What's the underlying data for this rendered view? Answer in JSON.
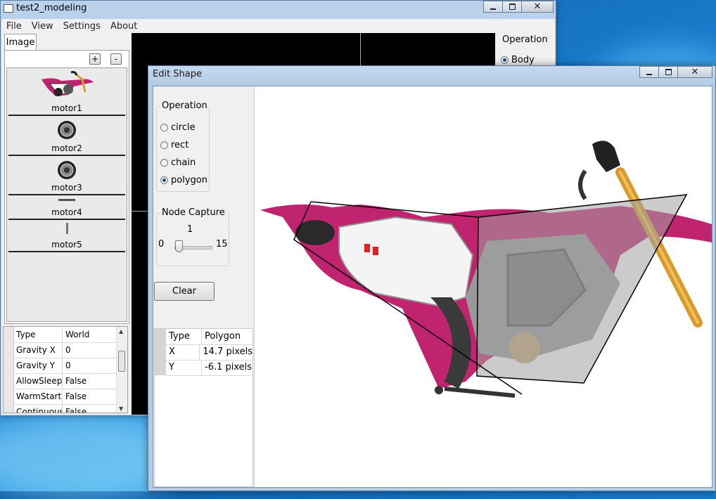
{
  "main_window": {
    "title": "test2_modeling",
    "menu": [
      "File",
      "View",
      "Settings",
      "About"
    ],
    "tab": "Image",
    "add_label": "+",
    "remove_label": "-",
    "images": [
      {
        "label": "motor1"
      },
      {
        "label": "motor2"
      },
      {
        "label": "motor3"
      },
      {
        "label": "motor4"
      },
      {
        "label": "motor5"
      }
    ],
    "properties": [
      {
        "key": "Type",
        "value": "World"
      },
      {
        "key": "Gravity X",
        "value": "0"
      },
      {
        "key": "Gravity Y",
        "value": "0"
      },
      {
        "key": "AllowSleep",
        "value": "False"
      },
      {
        "key": "WarmStarti",
        "value": "False"
      },
      {
        "key": "Continuous",
        "value": "False"
      }
    ],
    "operation_title": "Operation",
    "operation_selected": "Body"
  },
  "edit_dialog": {
    "title": "Edit Shape",
    "operation_title": "Operation",
    "options": [
      "circle",
      "rect",
      "chain",
      "polygon"
    ],
    "selected": "polygon",
    "node_capture_title": "Node Capture",
    "slider_value": "1",
    "slider_min": "0",
    "slider_max": "15",
    "clear_label": "Clear",
    "info": [
      {
        "key": "Type",
        "value": "Polygon"
      },
      {
        "key": "X",
        "value": "14.7 pixels"
      },
      {
        "key": "Y",
        "value": "-6.1 pixels"
      }
    ]
  },
  "colors": {
    "bike_magenta": "#c0246f",
    "desktop_blue": "#1a7fd0"
  }
}
